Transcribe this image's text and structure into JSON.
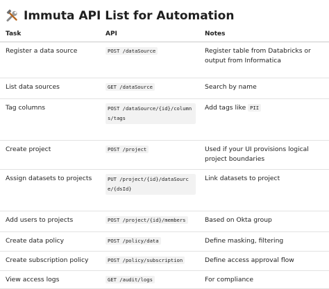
{
  "title": "Immuta API List for Automation",
  "title_icon": "tools-icon",
  "table": {
    "headers": [
      "Task",
      "API",
      "Notes"
    ],
    "rows": [
      {
        "task": "Register a data source",
        "api": "POST /dataSource",
        "notes": "Register table from Databricks or output from Informatica"
      },
      {
        "task": "List data sources",
        "api": "GET /dataSource",
        "notes": "Search by name"
      },
      {
        "task": "Tag columns",
        "api": "POST /dataSource/{id}/columns/tags",
        "notes_prefix": "Add tags like ",
        "notes_code": "PII"
      },
      {
        "task": "Create project",
        "api": "POST /project",
        "notes": "Used if your UI provisions logical project boundaries"
      },
      {
        "task": "Assign datasets to projects",
        "api": "PUT /project/{id}/dataSource/{dsId}",
        "notes": "Link datasets to project"
      },
      {
        "task": "Add users to projects",
        "api": "POST /project/{id}/members",
        "notes": "Based on Okta group"
      },
      {
        "task": "Create data policy",
        "api": "POST /policy/data",
        "notes": "Define masking, filtering"
      },
      {
        "task": "Create subscription policy",
        "api": "POST /policy/subscription",
        "notes": "Define access approval flow"
      },
      {
        "task": "View access logs",
        "api": "GET /audit/logs",
        "notes": "For compliance"
      }
    ]
  }
}
